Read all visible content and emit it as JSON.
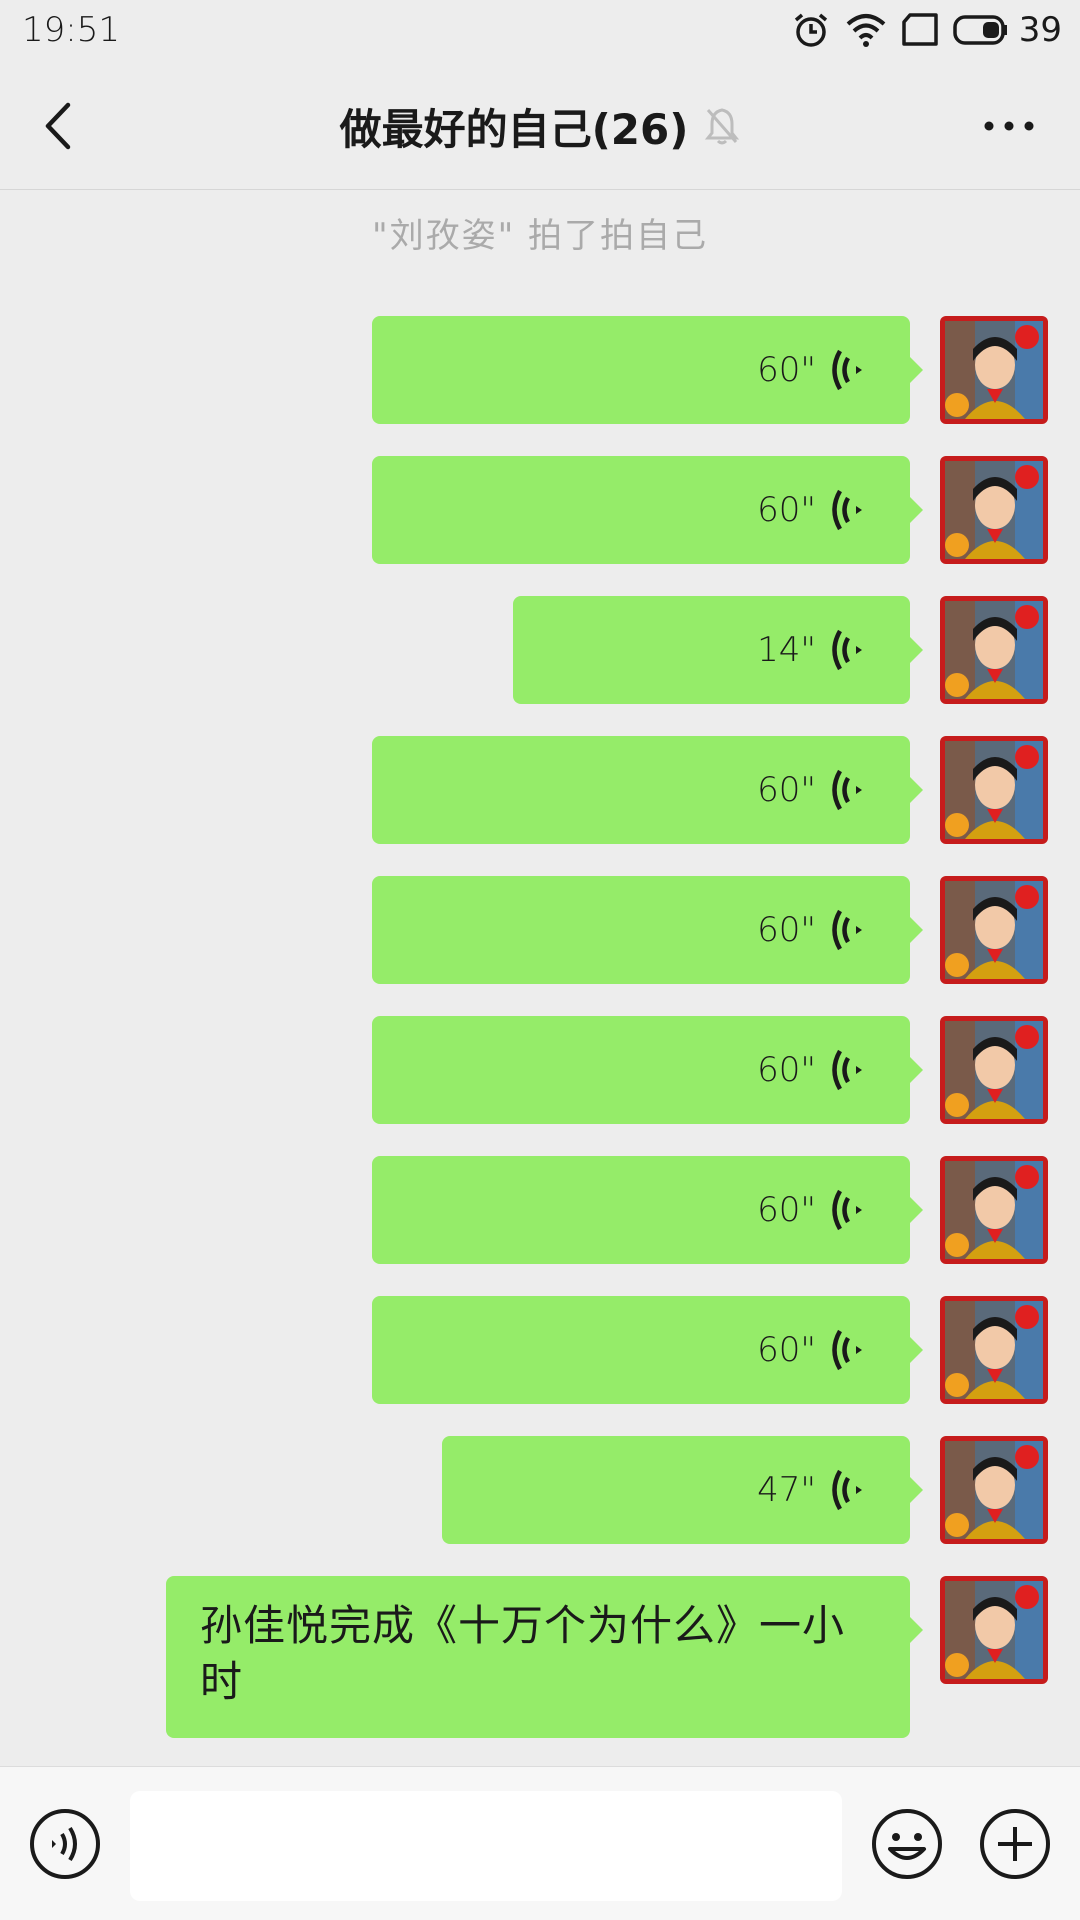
{
  "status_bar": {
    "time": "19:51",
    "battery": "39",
    "icons": [
      "alarm-icon",
      "wifi-icon",
      "sim-card-icon",
      "battery-icon"
    ]
  },
  "header": {
    "title": "做最好的自己(26)",
    "back_icon": "back-chevron-icon",
    "mute_icon": "muted-bell-icon",
    "more_icon": "more-dots-icon"
  },
  "notice": "\"刘孜姿\" 拍了拍自己",
  "messages": [
    {
      "type": "voice",
      "duration": "60\""
    },
    {
      "type": "voice",
      "duration": "60\""
    },
    {
      "type": "voice",
      "duration": "14\""
    },
    {
      "type": "voice",
      "duration": "60\""
    },
    {
      "type": "voice",
      "duration": "60\""
    },
    {
      "type": "voice",
      "duration": "60\""
    },
    {
      "type": "voice",
      "duration": "60\""
    },
    {
      "type": "voice",
      "duration": "60\""
    },
    {
      "type": "voice",
      "duration": "47\""
    },
    {
      "type": "text",
      "text": "孙佳悦完成《十万个为什么》一小时"
    }
  ],
  "input_bar": {
    "input_value": "",
    "voice_icon": "voice-input-icon",
    "emoji_icon": "emoji-icon",
    "plus_icon": "plus-icon"
  },
  "colors": {
    "bubble": "#95ec69",
    "background": "#ededed",
    "avatar_frame": "#c61c1c"
  }
}
